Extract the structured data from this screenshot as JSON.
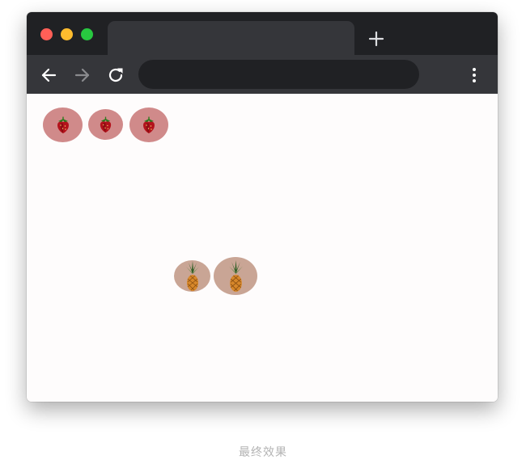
{
  "browser": {
    "tab_title": "",
    "address_bar_value": "",
    "colors": {
      "titlebar": "#202124",
      "toolbar": "#35363a",
      "close": "#ff5f57",
      "minimize": "#febc2e",
      "maximize": "#28c840"
    },
    "icons": {
      "back": "arrow-left-icon",
      "forward": "arrow-right-icon",
      "reload": "reload-icon",
      "new_tab": "plus-icon",
      "menu": "kebab-menu-icon"
    }
  },
  "page": {
    "strawberries": [
      "strawberry",
      "strawberry",
      "strawberry"
    ],
    "pineapples": [
      "pineapple",
      "pineapple"
    ]
  },
  "caption": "最终效果"
}
